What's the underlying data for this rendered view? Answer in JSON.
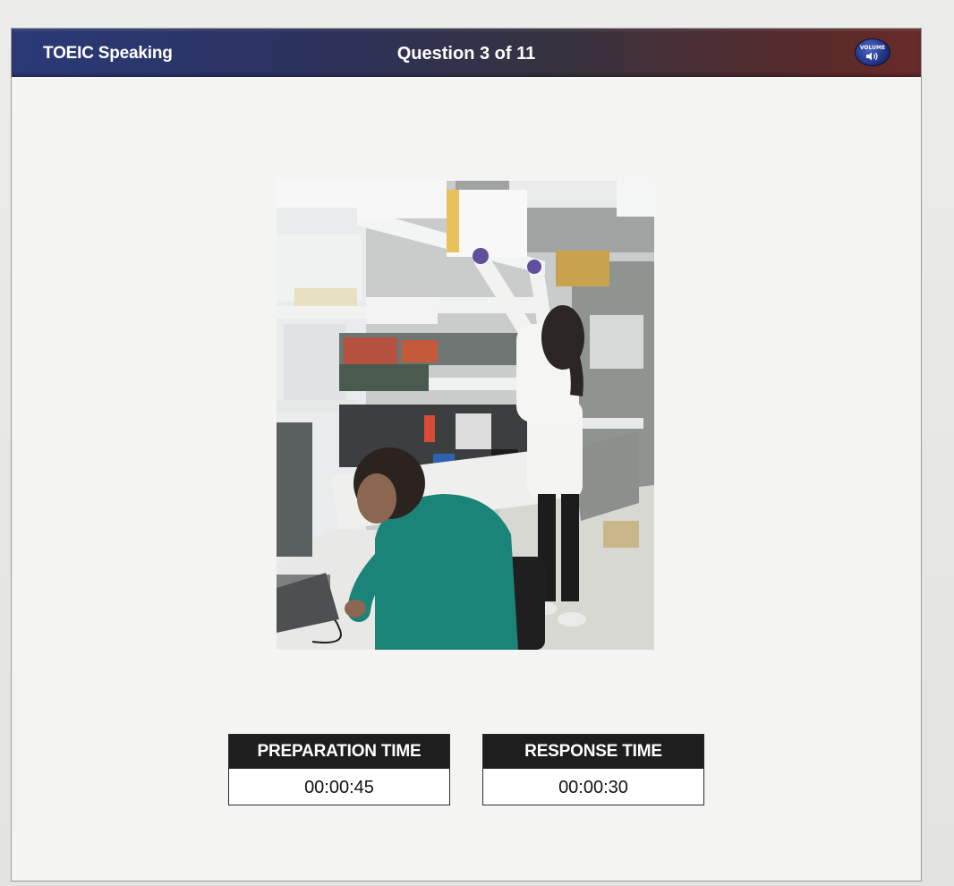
{
  "header": {
    "app_title": "TOEIC Speaking",
    "question_counter": "Question 3 of 11",
    "volume_label": "VOLUME",
    "volume_icon": "speaker-icon"
  },
  "colors": {
    "header_start": "#2a3a78",
    "header_end": "#6a2a2a",
    "timer_label_bg": "#1e1e1e"
  },
  "photo": {
    "subject": "laboratory scene"
  },
  "timers": {
    "preparation": {
      "label": "PREPARATION TIME",
      "value": "00:00:45"
    },
    "response": {
      "label": "RESPONSE TIME",
      "value": "00:00:30"
    }
  }
}
